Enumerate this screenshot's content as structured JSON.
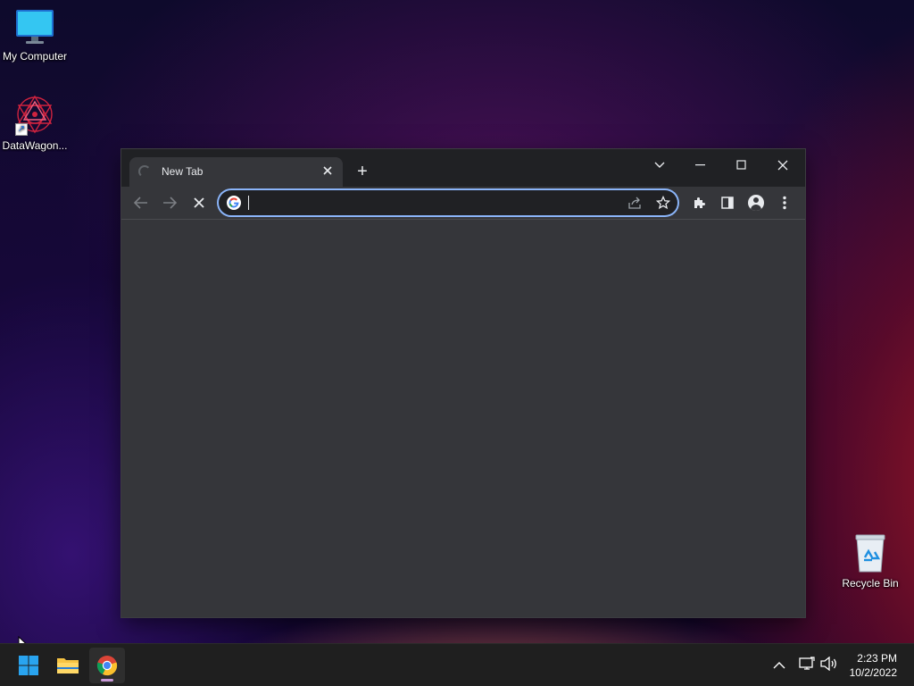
{
  "desktop": {
    "icons": [
      {
        "label": "My Computer",
        "icon": "monitor-icon"
      },
      {
        "label": "DataWagon...",
        "icon": "datawagon-icon"
      },
      {
        "label": "Recycle Bin",
        "icon": "recycle-bin-icon"
      }
    ]
  },
  "browser": {
    "tab": {
      "title": "New Tab",
      "loading": true
    },
    "new_tab_symbol": "+",
    "omnibox": {
      "value": "",
      "placeholder": ""
    },
    "colors": {
      "frame": "#202124",
      "toolbar": "#35363a",
      "focus_ring": "#8ab4f8",
      "text": "#e8eaed"
    }
  },
  "taskbar": {
    "apps": [
      "start-icon",
      "file-explorer-icon",
      "chrome-icon"
    ],
    "active_app": "chrome-icon",
    "tray": {
      "time": "2:23 PM",
      "date": "10/2/2022",
      "icons": [
        "chevron-up-icon",
        "network-icon",
        "volume-icon"
      ]
    }
  }
}
